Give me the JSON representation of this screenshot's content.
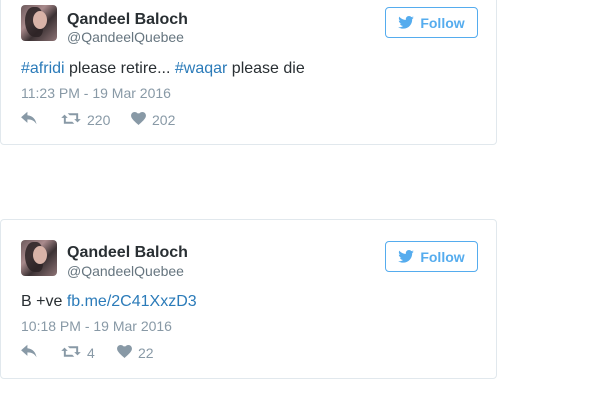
{
  "tweets": [
    {
      "author_name": "Qandeel Baloch",
      "author_handle": "@QandeelQuebee",
      "follow_label": "Follow",
      "text_parts": {
        "hashtag1": "#afridi",
        "middle": " please retire... ",
        "hashtag2": "#waqar",
        "end": " please die"
      },
      "timestamp": "11:23 PM - 19 Mar 2016",
      "retweet_count": "220",
      "like_count": "202"
    },
    {
      "author_name": "Qandeel Baloch",
      "author_handle": "@QandeelQuebee",
      "follow_label": "Follow",
      "text_parts": {
        "prefix": "B +ve ",
        "link": "fb.me/2C41XxzD3"
      },
      "timestamp": "10:18 PM - 19 Mar 2016",
      "retweet_count": "4",
      "like_count": "22"
    }
  ],
  "colors": {
    "accent": "#55acee",
    "link": "#2b7bb9",
    "muted": "#8899a6",
    "text": "#292f33",
    "border": "#e1e8ed"
  },
  "icons": [
    "twitter-bird-icon",
    "reply-icon",
    "retweet-icon",
    "heart-icon"
  ]
}
